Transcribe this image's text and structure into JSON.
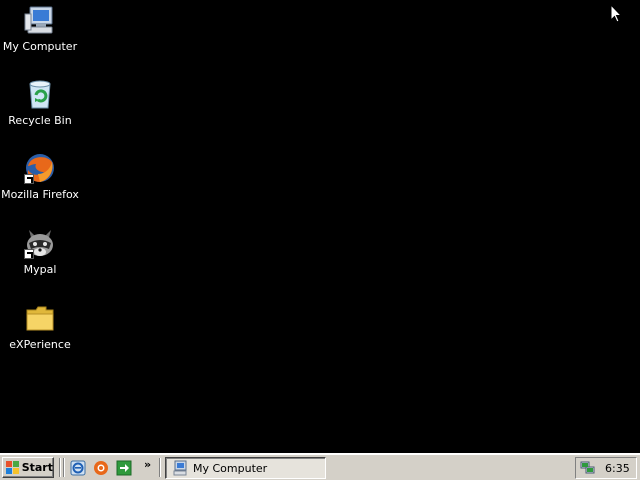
{
  "desktop": {
    "icons": [
      {
        "label": "My Computer",
        "icon": "my-computer-icon"
      },
      {
        "label": "Recycle Bin",
        "icon": "recycle-bin-icon"
      },
      {
        "label": "Mozilla Firefox",
        "icon": "firefox-icon"
      },
      {
        "label": "Mypal",
        "icon": "mypal-raccoon-icon"
      },
      {
        "label": "eXPerience",
        "icon": "folder-icon"
      }
    ],
    "background_color": "#000000"
  },
  "taskbar": {
    "start_label": "Start",
    "quick_launch": [
      {
        "icon": "internet-explorer-icon"
      },
      {
        "icon": "orange-browser-icon"
      },
      {
        "icon": "green-arrow-icon"
      }
    ],
    "overflow_chevron": "»",
    "tasks": [
      {
        "label": "My Computer",
        "icon": "my-computer-icon"
      }
    ],
    "tray": {
      "icons": [
        "network-icon"
      ],
      "clock": "6:35"
    }
  }
}
